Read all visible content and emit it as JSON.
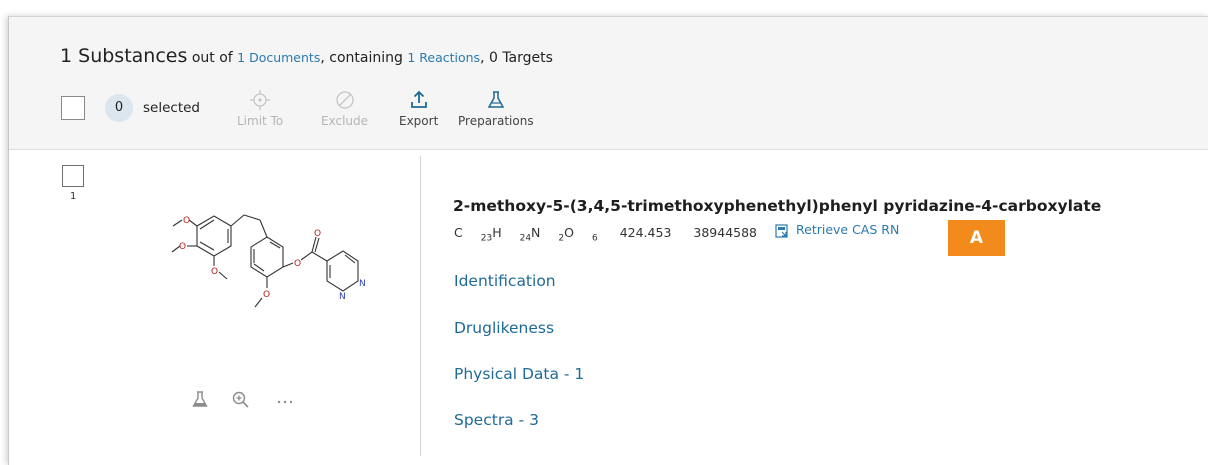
{
  "summary": {
    "count_label": "1 Substances",
    "out_of": "out of",
    "documents_link": "1 Documents",
    "containing": ", containing",
    "reactions_link": "1 Reactions",
    "targets_text": ", 0 Targets"
  },
  "selection": {
    "count": "0",
    "label": "selected"
  },
  "toolbar": [
    {
      "label": "Limit To",
      "icon": "target-icon",
      "enabled": false
    },
    {
      "label": "Exclude",
      "icon": "block-icon",
      "enabled": false
    },
    {
      "label": "Export",
      "icon": "upload-icon",
      "enabled": true
    },
    {
      "label": "Preparations",
      "icon": "flask-icon",
      "enabled": true
    }
  ],
  "result": {
    "index": "1",
    "name": "2-methoxy-5-(3,4,5-trimethoxyphenethyl)phenyl pyridazine-4-carboxylate",
    "formula": {
      "c": "C",
      "c_n": "23",
      "h": "H",
      "h_n": "24",
      "n": "N",
      "n_n": "2",
      "o": "O",
      "o_n": "6"
    },
    "molecular_weight": "424.453",
    "reaxys_id": "38944588",
    "cas_link": "Retrieve CAS RN",
    "links": [
      "Identification",
      "Druglikeness",
      "Physical Data - 1",
      "Spectra - 3"
    ],
    "structure_atoms": {
      "o": "O",
      "n": "N"
    },
    "actions": [
      "flask-icon",
      "zoom-in-icon",
      "more-icon"
    ]
  },
  "annotation": {
    "badge": "A",
    "color": "#f28b1c"
  },
  "colors": {
    "link": "#2a7ab0",
    "header_bg": "#f5f5f5"
  }
}
